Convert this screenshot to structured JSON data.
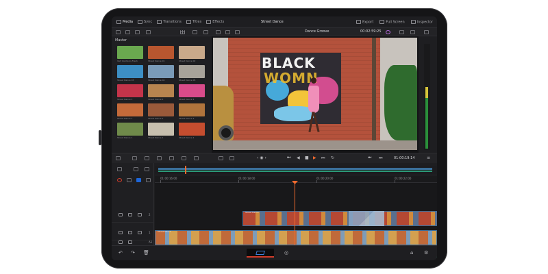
{
  "app": {
    "project_title": "Street Dance"
  },
  "topbar": {
    "left_items": [
      {
        "label": "Media",
        "icon": "media-icon",
        "active": true
      },
      {
        "label": "Sync",
        "icon": "sync-icon",
        "active": false
      },
      {
        "label": "Transitions",
        "icon": "transitions-icon",
        "active": false
      },
      {
        "label": "Titles",
        "icon": "titles-icon",
        "active": false
      },
      {
        "label": "Effects",
        "icon": "effects-icon",
        "active": false
      }
    ],
    "right_items": [
      {
        "label": "Export",
        "icon": "export-icon"
      },
      {
        "label": "Full Screen",
        "icon": "fullscreen-icon"
      },
      {
        "label": "Inspector",
        "icon": "inspector-icon"
      }
    ]
  },
  "toolbar": {
    "clip_name": "Dance Groove",
    "timecode": "00:02:59:25"
  },
  "media_pool": {
    "title": "Master",
    "clips": [
      {
        "label": "Vert Outdoors Fresh",
        "color": "#6aa84f"
      },
      {
        "label": "Street Dance 01",
        "color": "#b8562f"
      },
      {
        "label": "Street Dance 02",
        "color": "#c9a98a"
      },
      {
        "label": "Street Dance 03",
        "color": "#3d8fc4"
      },
      {
        "label": "Street Dance 04",
        "color": "#7a9bb8"
      },
      {
        "label": "Street Dance 05",
        "color": "#a8a39a"
      },
      {
        "label": "Street Dance 1",
        "color": "#c4344a"
      },
      {
        "label": "Street Dance 1",
        "color": "#b7844f"
      },
      {
        "label": "Street Dance 1",
        "color": "#d94b8a"
      },
      {
        "label": "Street Dance 1",
        "color": "#c46a3a"
      },
      {
        "label": "Street Dance 1",
        "color": "#9a5a3a"
      },
      {
        "label": "Street Dance 1",
        "color": "#b0743c"
      },
      {
        "label": "Street Dance 1",
        "color": "#6f8a4a"
      },
      {
        "label": "Street Dance 1",
        "color": "#c7bfae"
      },
      {
        "label": "Street Dance 1",
        "color": "#c54d2f"
      }
    ]
  },
  "viewer": {
    "mural_line1": "BLACK",
    "mural_line2": "WOMN"
  },
  "transport": {
    "timecode": "01:00:19:14"
  },
  "timeline": {
    "ruler": [
      "01:00:16:00",
      "01:00:18:00",
      "01:00:20:00",
      "01:00:22:00"
    ],
    "tracks": [
      {
        "name": "2",
        "clip_label": "Street Dance"
      },
      {
        "name": "1",
        "clip_label": "Street Dance"
      },
      {
        "name": "A1",
        "clip_label": "Dance Groove"
      }
    ]
  },
  "colors": {
    "accent": "#f16a2e",
    "video_clip_border": "#3c6e9a",
    "audio_clip": "#1e7d5b"
  }
}
